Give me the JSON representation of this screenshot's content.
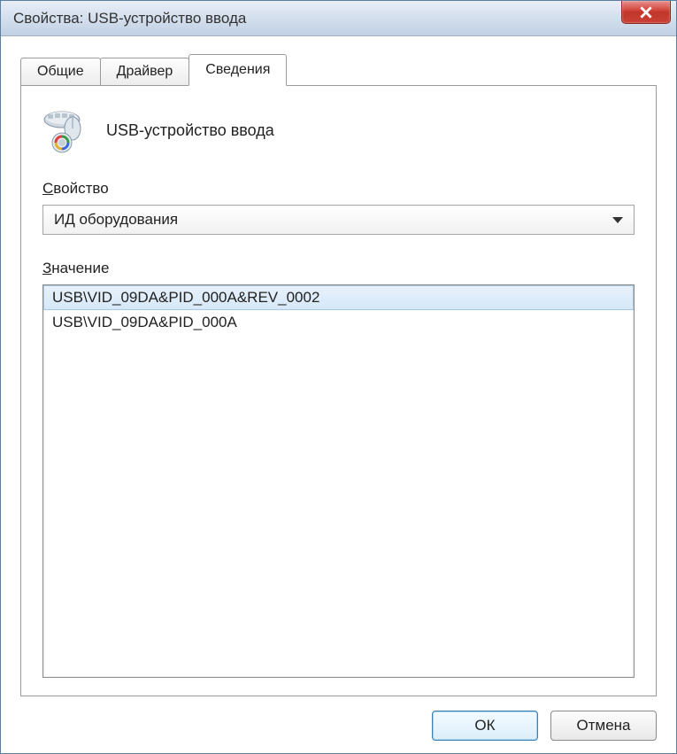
{
  "window": {
    "title": "Свойства: USB-устройство ввода"
  },
  "tabs": [
    {
      "label": "Общие"
    },
    {
      "label": "Драйвер"
    },
    {
      "label": "Сведения"
    }
  ],
  "device": {
    "name": "USB-устройство ввода"
  },
  "property_section": {
    "label_prefix": "С",
    "label_rest": "войство",
    "selected": "ИД оборудования"
  },
  "value_section": {
    "label_prefix": "З",
    "label_rest": "начение",
    "items": [
      {
        "text": "USB\\VID_09DA&PID_000A&REV_0002",
        "selected": true
      },
      {
        "text": "USB\\VID_09DA&PID_000A",
        "selected": false
      }
    ]
  },
  "buttons": {
    "ok": "ОК",
    "cancel": "Отмена"
  }
}
